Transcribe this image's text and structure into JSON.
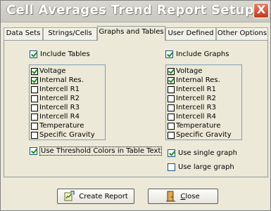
{
  "window": {
    "title": "Cell Averages Trend Report Setup",
    "close_glyph": "X"
  },
  "tabs": [
    {
      "label": "Data Sets"
    },
    {
      "label": "Strings/Cells"
    },
    {
      "label": "Graphs and Tables",
      "active": true
    },
    {
      "label": "User Defined"
    },
    {
      "label": "Other Options"
    }
  ],
  "tables": {
    "include_label": "Include Tables",
    "include_checked": true,
    "items": [
      {
        "label": "Voltage",
        "checked": true
      },
      {
        "label": "Internal Res.",
        "checked": true
      },
      {
        "label": "Intercell R1",
        "checked": false
      },
      {
        "label": "Intercell R2",
        "checked": false
      },
      {
        "label": "Intercell R3",
        "checked": false
      },
      {
        "label": "Intercell R4",
        "checked": false
      },
      {
        "label": "Temperature",
        "checked": false
      },
      {
        "label": "Specific Gravity",
        "checked": false
      }
    ],
    "threshold_label": "Use Threshold Colors in Table Text",
    "threshold_checked": true
  },
  "graphs": {
    "include_label": "Include Graphs",
    "include_checked": true,
    "items": [
      {
        "label": "Voltage",
        "checked": true
      },
      {
        "label": "Internal Res.",
        "checked": true
      },
      {
        "label": "Intercell R1",
        "checked": false
      },
      {
        "label": "Intercell R2",
        "checked": false
      },
      {
        "label": "Intercell R3",
        "checked": false
      },
      {
        "label": "Intercell R4",
        "checked": false
      },
      {
        "label": "Temperature",
        "checked": false
      },
      {
        "label": "Specific Gravity",
        "checked": false
      }
    ],
    "single_label": "Use single graph",
    "single_checked": true,
    "large_label": "Use large graph",
    "large_checked": false
  },
  "buttons": {
    "create_report": "Create Report",
    "close_underlined": "C",
    "close_rest": "lose"
  }
}
